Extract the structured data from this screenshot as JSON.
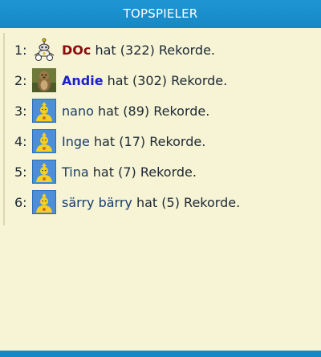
{
  "header": {
    "title": "TOPSPIELER"
  },
  "players": [
    {
      "rank": "1:",
      "name": "DOc",
      "verb": "hat",
      "count": "(322)",
      "suffix": "Rekorde.",
      "avatar": "robot-avatar"
    },
    {
      "rank": "2:",
      "name": "Andie",
      "verb": "hat",
      "count": "(302)",
      "suffix": "Rekorde.",
      "avatar": "marmot-photo-avatar"
    },
    {
      "rank": "3:",
      "name": "nano",
      "verb": "hat",
      "count": "(89)",
      "suffix": "Rekorde.",
      "avatar": "default-avatar"
    },
    {
      "rank": "4:",
      "name": "Inge",
      "verb": "hat",
      "count": "(17)",
      "suffix": "Rekorde.",
      "avatar": "default-avatar"
    },
    {
      "rank": "5:",
      "name": "Tina",
      "verb": "hat",
      "count": "(7)",
      "suffix": "Rekorde.",
      "avatar": "default-avatar"
    },
    {
      "rank": "6:",
      "name": "särry bärry",
      "verb": "hat",
      "count": "(5)",
      "suffix": "Rekorde.",
      "avatar": "default-avatar"
    }
  ],
  "colors": {
    "header_bg": "#1e96d3",
    "page_bg": "#f6f4d4",
    "name_first": "#8a0d0d",
    "name_second": "#1b1fd0",
    "name_default": "#173c6c"
  }
}
